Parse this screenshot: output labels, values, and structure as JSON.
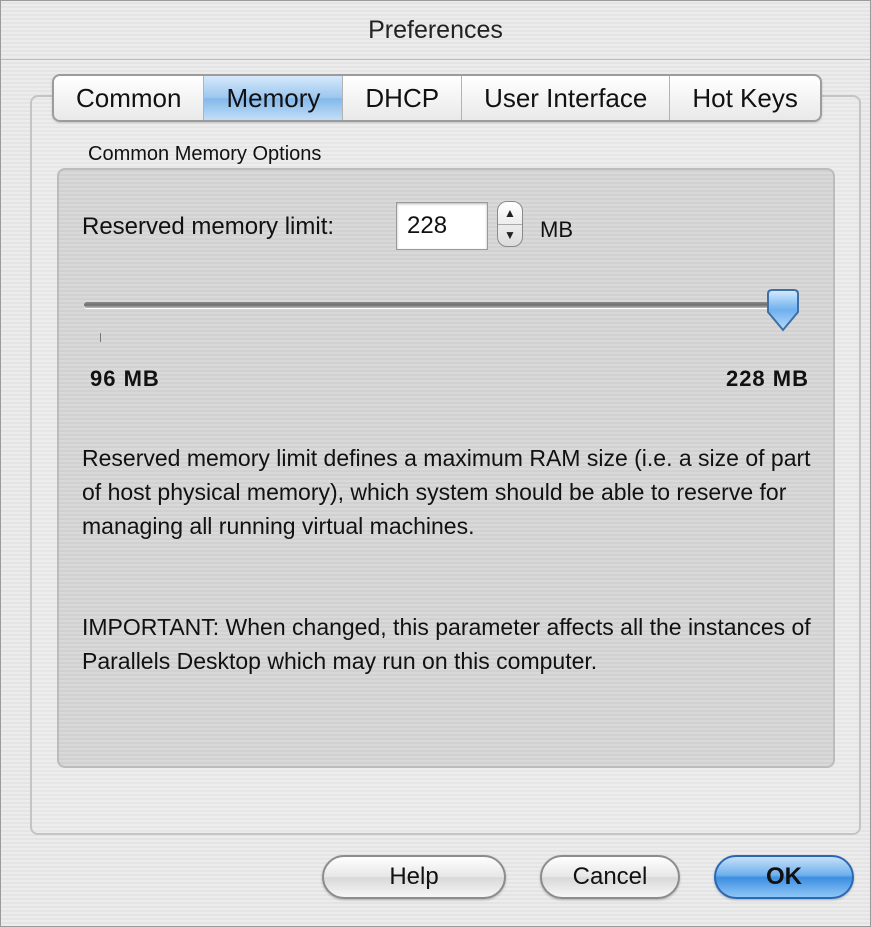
{
  "window": {
    "title": "Preferences"
  },
  "tabs": [
    {
      "label": "Common",
      "active": false
    },
    {
      "label": "Memory",
      "active": true
    },
    {
      "label": "DHCP",
      "active": false
    },
    {
      "label": "User Interface",
      "active": false
    },
    {
      "label": "Hot Keys",
      "active": false
    }
  ],
  "memory": {
    "group_label": "Common Memory Options",
    "limit_label": "Reserved memory limit:",
    "limit_value": "228",
    "unit": "MB",
    "slider": {
      "min_label": "96 MB",
      "max_label": "228 MB",
      "level": 1.0
    },
    "description": "Reserved memory limit defines a maximum RAM size (i.e. a size of part of host physical memory), which system should be able to reserve for managing all running virtual machines.",
    "important": "IMPORTANT: When changed, this parameter affects all the instances of Parallels Desktop which may run on this computer."
  },
  "buttons": {
    "help": "Help",
    "cancel": "Cancel",
    "ok": "OK"
  },
  "colors": {
    "accent": "#3d8fe1",
    "tab_active": "#9cc6ee"
  },
  "icons": {
    "step_up": "triangle-up",
    "step_down": "triangle-down",
    "slider_thumb": "pointer-down"
  }
}
